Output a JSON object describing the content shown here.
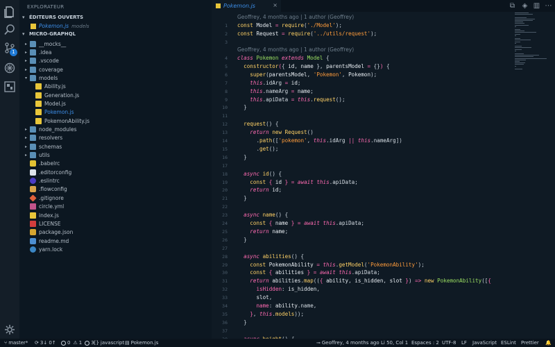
{
  "sidebar": {
    "title": "EXPLORATEUR",
    "open_editors_title": "ÉDITEURS OUVERTS",
    "open_editor_file": "Pokemon.js",
    "open_editor_path": "models",
    "project_title": "MICRO-GRAPHQL",
    "tree": [
      {
        "label": "__mocks__",
        "type": "folder",
        "depth": 1,
        "expanded": false
      },
      {
        "label": ".idea",
        "type": "folder",
        "depth": 1,
        "expanded": false
      },
      {
        "label": ".vscode",
        "type": "folder",
        "depth": 1,
        "expanded": false
      },
      {
        "label": "coverage",
        "type": "folder",
        "depth": 1,
        "expanded": false
      },
      {
        "label": "models",
        "type": "folder",
        "depth": 1,
        "expanded": true
      },
      {
        "label": "Ability.js",
        "type": "js",
        "depth": 2
      },
      {
        "label": "Generation.js",
        "type": "js",
        "depth": 2
      },
      {
        "label": "Model.js",
        "type": "js",
        "depth": 2
      },
      {
        "label": "Pokemon.js",
        "type": "js",
        "depth": 2,
        "active": true
      },
      {
        "label": "PokemonAbility.js",
        "type": "js",
        "depth": 2
      },
      {
        "label": "node_modules",
        "type": "folder",
        "depth": 1,
        "expanded": false
      },
      {
        "label": "resolvers",
        "type": "folder",
        "depth": 1,
        "expanded": false
      },
      {
        "label": "schemas",
        "type": "folder",
        "depth": 1,
        "expanded": false
      },
      {
        "label": "utils",
        "type": "folder",
        "depth": 1,
        "expanded": false
      },
      {
        "label": ".babelrc",
        "type": "babel",
        "depth": 1
      },
      {
        "label": ".editorconfig",
        "type": "edcfg",
        "depth": 1
      },
      {
        "label": ".eslintrc",
        "type": "eslint",
        "depth": 1
      },
      {
        "label": ".flowconfig",
        "type": "flow",
        "depth": 1
      },
      {
        "label": ".gitignore",
        "type": "git",
        "depth": 1
      },
      {
        "label": "circle.yml",
        "type": "yml",
        "depth": 1
      },
      {
        "label": "index.js",
        "type": "js",
        "depth": 1
      },
      {
        "label": "LICENSE",
        "type": "lic",
        "depth": 1
      },
      {
        "label": "package.json",
        "type": "json",
        "depth": 1
      },
      {
        "label": "readme.md",
        "type": "md",
        "depth": 1
      },
      {
        "label": "yarn.lock",
        "type": "yarn",
        "depth": 1
      }
    ]
  },
  "activity": {
    "scm_badge": "1",
    "icons": [
      "files-icon",
      "search-icon",
      "source-control-icon",
      "debug-icon",
      "extensions-icon"
    ]
  },
  "editor": {
    "tab_label": "Pokemon.js",
    "tab_close": "×",
    "blame_1": "Geoffrey, 4 months ago | 1 author (Geoffrey)",
    "blame_2": "Geoffrey, 4 months ago | 1 author (Geoffrey)",
    "lines": [
      {
        "n": "1",
        "tokens": [
          [
            "kw",
            "const "
          ],
          [
            "id",
            "Model "
          ],
          [
            "op",
            "= "
          ],
          [
            "fn",
            "require"
          ],
          [
            "pun",
            "("
          ],
          [
            "str",
            "'./Model'"
          ],
          [
            "pun",
            ");"
          ]
        ]
      },
      {
        "n": "2",
        "tokens": [
          [
            "kw",
            "const "
          ],
          [
            "id",
            "Request "
          ],
          [
            "op",
            "= "
          ],
          [
            "fn",
            "require"
          ],
          [
            "pun",
            "("
          ],
          [
            "str",
            "'../utils/request'"
          ],
          [
            "pun",
            ");"
          ]
        ]
      },
      {
        "n": "3",
        "tokens": []
      },
      {
        "n": "4",
        "tokens": [
          [
            "it",
            "class "
          ],
          [
            "cl",
            "Pokemon "
          ],
          [
            "it",
            "extends "
          ],
          [
            "cl",
            "Model "
          ],
          [
            "pun",
            "{"
          ]
        ]
      },
      {
        "n": "5",
        "tokens": [
          [
            "id",
            "  "
          ],
          [
            "fn",
            "constructor"
          ],
          [
            "br",
            "("
          ],
          [
            "pun",
            "{ "
          ],
          [
            "id",
            "id"
          ],
          [
            "pun",
            ", "
          ],
          [
            "id",
            "name "
          ],
          [
            "pun",
            "}, "
          ],
          [
            "id",
            "parentsModel "
          ],
          [
            "op",
            "= "
          ],
          [
            "pun",
            "{}"
          ],
          [
            "br",
            ") "
          ],
          [
            "pun",
            "{"
          ]
        ]
      },
      {
        "n": "6",
        "tokens": [
          [
            "id",
            "    "
          ],
          [
            "fn",
            "super"
          ],
          [
            "pun",
            "("
          ],
          [
            "id",
            "parentsModel"
          ],
          [
            "pun",
            ", "
          ],
          [
            "str",
            "'Pokemon'"
          ],
          [
            "pun",
            ", "
          ],
          [
            "id",
            "Pokemon"
          ],
          [
            "pun",
            ");"
          ]
        ]
      },
      {
        "n": "7",
        "tokens": [
          [
            "id",
            "    "
          ],
          [
            "th",
            "this"
          ],
          [
            "pun",
            "."
          ],
          [
            "pr",
            "idArg "
          ],
          [
            "op",
            "= "
          ],
          [
            "id",
            "id"
          ],
          [
            "pun",
            ";"
          ]
        ]
      },
      {
        "n": "8",
        "tokens": [
          [
            "id",
            "    "
          ],
          [
            "th",
            "this"
          ],
          [
            "pun",
            "."
          ],
          [
            "pr",
            "nameArg "
          ],
          [
            "op",
            "= "
          ],
          [
            "id",
            "name"
          ],
          [
            "pun",
            ";"
          ]
        ]
      },
      {
        "n": "9",
        "tokens": [
          [
            "id",
            "    "
          ],
          [
            "th",
            "this"
          ],
          [
            "pun",
            "."
          ],
          [
            "pr",
            "apiData "
          ],
          [
            "op",
            "= "
          ],
          [
            "th",
            "this"
          ],
          [
            "pun",
            "."
          ],
          [
            "fn",
            "request"
          ],
          [
            "pun",
            "();"
          ]
        ]
      },
      {
        "n": "10",
        "tokens": [
          [
            "id",
            "  "
          ],
          [
            "pun",
            "}"
          ]
        ]
      },
      {
        "n": "11",
        "tokens": []
      },
      {
        "n": "12",
        "tokens": [
          [
            "id",
            "  "
          ],
          [
            "fn",
            "request"
          ],
          [
            "pun",
            "() {"
          ]
        ]
      },
      {
        "n": "13",
        "tokens": [
          [
            "id",
            "    "
          ],
          [
            "it",
            "return "
          ],
          [
            "kw",
            "new "
          ],
          [
            "fn",
            "Request"
          ],
          [
            "pun",
            "()"
          ]
        ]
      },
      {
        "n": "14",
        "tokens": [
          [
            "id",
            "      "
          ],
          [
            "pun",
            "."
          ],
          [
            "fn",
            "path"
          ],
          [
            "pun",
            "(["
          ],
          [
            "str",
            "'pokemon'"
          ],
          [
            "pun",
            ", "
          ],
          [
            "th",
            "this"
          ],
          [
            "pun",
            "."
          ],
          [
            "pr",
            "idArg "
          ],
          [
            "op",
            "|| "
          ],
          [
            "th",
            "this"
          ],
          [
            "pun",
            "."
          ],
          [
            "pr",
            "nameArg"
          ],
          [
            "pun",
            "])"
          ]
        ]
      },
      {
        "n": "15",
        "tokens": [
          [
            "id",
            "      "
          ],
          [
            "pun",
            "."
          ],
          [
            "fn",
            "get"
          ],
          [
            "pun",
            "();"
          ]
        ]
      },
      {
        "n": "16",
        "tokens": [
          [
            "id",
            "  "
          ],
          [
            "pun",
            "}"
          ]
        ]
      },
      {
        "n": "17",
        "tokens": []
      },
      {
        "n": "18",
        "tokens": [
          [
            "id",
            "  "
          ],
          [
            "it",
            "async "
          ],
          [
            "fn",
            "id"
          ],
          [
            "pun",
            "() {"
          ]
        ]
      },
      {
        "n": "19",
        "tokens": [
          [
            "id",
            "    "
          ],
          [
            "kw",
            "const "
          ],
          [
            "br",
            "{ "
          ],
          [
            "id",
            "id "
          ],
          [
            "br",
            "} "
          ],
          [
            "op",
            "= "
          ],
          [
            "it",
            "await "
          ],
          [
            "th",
            "this"
          ],
          [
            "pun",
            "."
          ],
          [
            "pr",
            "apiData"
          ],
          [
            "pun",
            ";"
          ]
        ]
      },
      {
        "n": "20",
        "tokens": [
          [
            "id",
            "    "
          ],
          [
            "it",
            "return "
          ],
          [
            "id",
            "id"
          ],
          [
            "pun",
            ";"
          ]
        ]
      },
      {
        "n": "21",
        "tokens": [
          [
            "id",
            "  "
          ],
          [
            "pun",
            "}"
          ]
        ]
      },
      {
        "n": "22",
        "tokens": []
      },
      {
        "n": "23",
        "tokens": [
          [
            "id",
            "  "
          ],
          [
            "it",
            "async "
          ],
          [
            "fn",
            "name"
          ],
          [
            "pun",
            "() {"
          ]
        ]
      },
      {
        "n": "24",
        "tokens": [
          [
            "id",
            "    "
          ],
          [
            "kw",
            "const "
          ],
          [
            "br",
            "{ "
          ],
          [
            "id",
            "name "
          ],
          [
            "br",
            "} "
          ],
          [
            "op",
            "= "
          ],
          [
            "it",
            "await "
          ],
          [
            "th",
            "this"
          ],
          [
            "pun",
            "."
          ],
          [
            "pr",
            "apiData"
          ],
          [
            "pun",
            ";"
          ]
        ]
      },
      {
        "n": "25",
        "tokens": [
          [
            "id",
            "    "
          ],
          [
            "it",
            "return "
          ],
          [
            "id",
            "name"
          ],
          [
            "pun",
            ";"
          ]
        ]
      },
      {
        "n": "26",
        "tokens": [
          [
            "id",
            "  "
          ],
          [
            "pun",
            "}"
          ]
        ]
      },
      {
        "n": "27",
        "tokens": []
      },
      {
        "n": "28",
        "tokens": [
          [
            "id",
            "  "
          ],
          [
            "it",
            "async "
          ],
          [
            "fn",
            "abilities"
          ],
          [
            "pun",
            "() {"
          ]
        ]
      },
      {
        "n": "29",
        "tokens": [
          [
            "id",
            "    "
          ],
          [
            "kw",
            "const "
          ],
          [
            "id",
            "PokemonAbility "
          ],
          [
            "op",
            "= "
          ],
          [
            "th",
            "this"
          ],
          [
            "pun",
            "."
          ],
          [
            "fn",
            "getModel"
          ],
          [
            "pun",
            "("
          ],
          [
            "str",
            "'PokemonAbility'"
          ],
          [
            "pun",
            ");"
          ]
        ]
      },
      {
        "n": "30",
        "tokens": [
          [
            "id",
            "    "
          ],
          [
            "kw",
            "const "
          ],
          [
            "br",
            "{ "
          ],
          [
            "id",
            "abilities "
          ],
          [
            "br",
            "} "
          ],
          [
            "op",
            "= "
          ],
          [
            "it",
            "await "
          ],
          [
            "th",
            "this"
          ],
          [
            "pun",
            "."
          ],
          [
            "pr",
            "apiData"
          ],
          [
            "pun",
            ";"
          ]
        ]
      },
      {
        "n": "31",
        "tokens": [
          [
            "id",
            "    "
          ],
          [
            "it",
            "return "
          ],
          [
            "id",
            "abilities"
          ],
          [
            "pun",
            "."
          ],
          [
            "fn",
            "map"
          ],
          [
            "pun",
            "(("
          ],
          [
            "br",
            "{ "
          ],
          [
            "id",
            "ability"
          ],
          [
            "pun",
            ", "
          ],
          [
            "id",
            "is_hidden"
          ],
          [
            "pun",
            ", "
          ],
          [
            "id",
            "slot "
          ],
          [
            "br",
            "}"
          ],
          [
            "pun",
            ") "
          ],
          [
            "op",
            "=> "
          ],
          [
            "kw",
            "new "
          ],
          [
            "cl",
            "PokemonAbility"
          ],
          [
            "pun",
            "(["
          ],
          [
            "br",
            "{"
          ]
        ]
      },
      {
        "n": "32",
        "tokens": [
          [
            "id",
            "      "
          ],
          [
            "key",
            "isHidden"
          ],
          [
            "pun",
            ": "
          ],
          [
            "id",
            "is_hidden"
          ],
          [
            "pun",
            ","
          ]
        ]
      },
      {
        "n": "33",
        "tokens": [
          [
            "id",
            "      "
          ],
          [
            "id",
            "slot"
          ],
          [
            "pun",
            ","
          ]
        ]
      },
      {
        "n": "34",
        "tokens": [
          [
            "id",
            "      "
          ],
          [
            "key",
            "name"
          ],
          [
            "pun",
            ": "
          ],
          [
            "id",
            "ability"
          ],
          [
            "pun",
            "."
          ],
          [
            "pr",
            "name"
          ],
          [
            "pun",
            ","
          ]
        ]
      },
      {
        "n": "35",
        "tokens": [
          [
            "id",
            "    "
          ],
          [
            "br",
            "}"
          ],
          [
            "pun",
            ", "
          ],
          [
            "th",
            "this"
          ],
          [
            "pun",
            "."
          ],
          [
            "fn",
            "models"
          ],
          [
            "pun",
            "));"
          ]
        ]
      },
      {
        "n": "36",
        "tokens": [
          [
            "id",
            "  "
          ],
          [
            "pun",
            "}"
          ]
        ]
      },
      {
        "n": "37",
        "tokens": []
      },
      {
        "n": "38",
        "tokens": [
          [
            "id",
            "  "
          ],
          [
            "it",
            "async "
          ],
          [
            "fn",
            "height"
          ],
          [
            "pun",
            "() {"
          ]
        ]
      }
    ]
  },
  "status": {
    "branch": "master*",
    "sync": "3↓ 0↑",
    "errors": "0",
    "warnings": "1",
    "infos": "3",
    "language_id": "javascript",
    "file": "Pokemon.js",
    "blame": "Geoffrey, 4 months ago",
    "position": "Li 50, Col 1",
    "spaces": "Espaces : 2",
    "encoding": "UTF-8",
    "eol": "LF",
    "language": "JavaScript",
    "eslint": "ESLint",
    "prettier": "Prettier"
  },
  "colors": {
    "accent": "#3d8ee8",
    "background": "#0f1a24",
    "keyword": "#ffd166",
    "string": "#ff9c3b",
    "italic_keyword": "#ff6bb2",
    "class": "#9bdf62"
  }
}
